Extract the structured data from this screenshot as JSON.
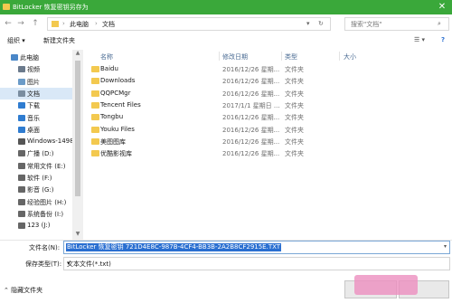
{
  "window": {
    "title": "BitLocker 恢复密钥另存为",
    "close_glyph": "✕"
  },
  "nav": {
    "back_glyph": "←",
    "forward_glyph": "→",
    "up_glyph": "↑",
    "breadcrumb": [
      "此电脑",
      "文档"
    ],
    "breadcrumb_sep": "›",
    "refresh_glyph": "↻",
    "search_placeholder": "搜索\"文档\""
  },
  "toolbar": {
    "organize": "组织 ▾",
    "new_folder": "新建文件夹",
    "view_glyph": "☰ ▾",
    "help_glyph": "?"
  },
  "sidebar": {
    "items": [
      {
        "label": "此电脑",
        "icon": "pc-icon",
        "color": "#4a87c8"
      },
      {
        "label": "视频",
        "icon": "video-icon",
        "color": "#6b7a8c"
      },
      {
        "label": "图片",
        "icon": "picture-icon",
        "color": "#6b9bc8"
      },
      {
        "label": "文档",
        "icon": "document-icon",
        "color": "#7a8da0"
      },
      {
        "label": "下载",
        "icon": "download-icon",
        "color": "#2f7cd0"
      },
      {
        "label": "音乐",
        "icon": "music-icon",
        "color": "#2f7cd0"
      },
      {
        "label": "桌面",
        "icon": "desktop-icon",
        "color": "#2f7cd0"
      },
      {
        "label": "Windows-1498",
        "icon": "drive-icon",
        "color": "#555555"
      },
      {
        "label": "广播 (D:)",
        "icon": "drive-icon",
        "color": "#666666"
      },
      {
        "label": "常用文件 (E:)",
        "icon": "drive-icon",
        "color": "#666666"
      },
      {
        "label": "软件 (F:)",
        "icon": "drive-icon",
        "color": "#666666"
      },
      {
        "label": "影音 (G:)",
        "icon": "drive-icon",
        "color": "#666666"
      },
      {
        "label": "经验图片 (H:)",
        "icon": "drive-icon",
        "color": "#666666"
      },
      {
        "label": "系统备份 (I:)",
        "icon": "drive-icon",
        "color": "#666666"
      },
      {
        "label": "123 (J:)",
        "icon": "drive-icon",
        "color": "#666666"
      }
    ],
    "selected_index": 3
  },
  "columns": {
    "name": "名称",
    "date": "修改日期",
    "type": "类型",
    "size": "大小"
  },
  "files": [
    {
      "name": "Baidu",
      "date": "2016/12/26 星期...",
      "type": "文件夹"
    },
    {
      "name": "Downloads",
      "date": "2016/12/26 星期...",
      "type": "文件夹"
    },
    {
      "name": "QQPCMgr",
      "date": "2016/12/26 星期...",
      "type": "文件夹"
    },
    {
      "name": "Tencent Files",
      "date": "2017/1/1 星期日 ...",
      "type": "文件夹"
    },
    {
      "name": "Tongbu",
      "date": "2016/12/26 星期...",
      "type": "文件夹"
    },
    {
      "name": "Youku Files",
      "date": "2016/12/26 星期...",
      "type": "文件夹"
    },
    {
      "name": "美图图库",
      "date": "2016/12/26 星期...",
      "type": "文件夹"
    },
    {
      "name": "优酷影视库",
      "date": "2016/12/26 星期...",
      "type": "文件夹"
    }
  ],
  "save": {
    "filename_label": "文件名(N):",
    "filename_value": "BitLocker 恢复密钥 721D4E8C-987B-4CF4-BB3B-2A2B8CF2915E.TXT",
    "filetype_label": "保存类型(T):",
    "filetype_value": "文本文件(*.txt)",
    "hide_folders": "隐藏文件夹",
    "dropdown_glyph": "▾"
  },
  "colors": {
    "titlebar": "#3aa83a",
    "selection": "#2a6fd1",
    "folder": "#f3c94f"
  }
}
